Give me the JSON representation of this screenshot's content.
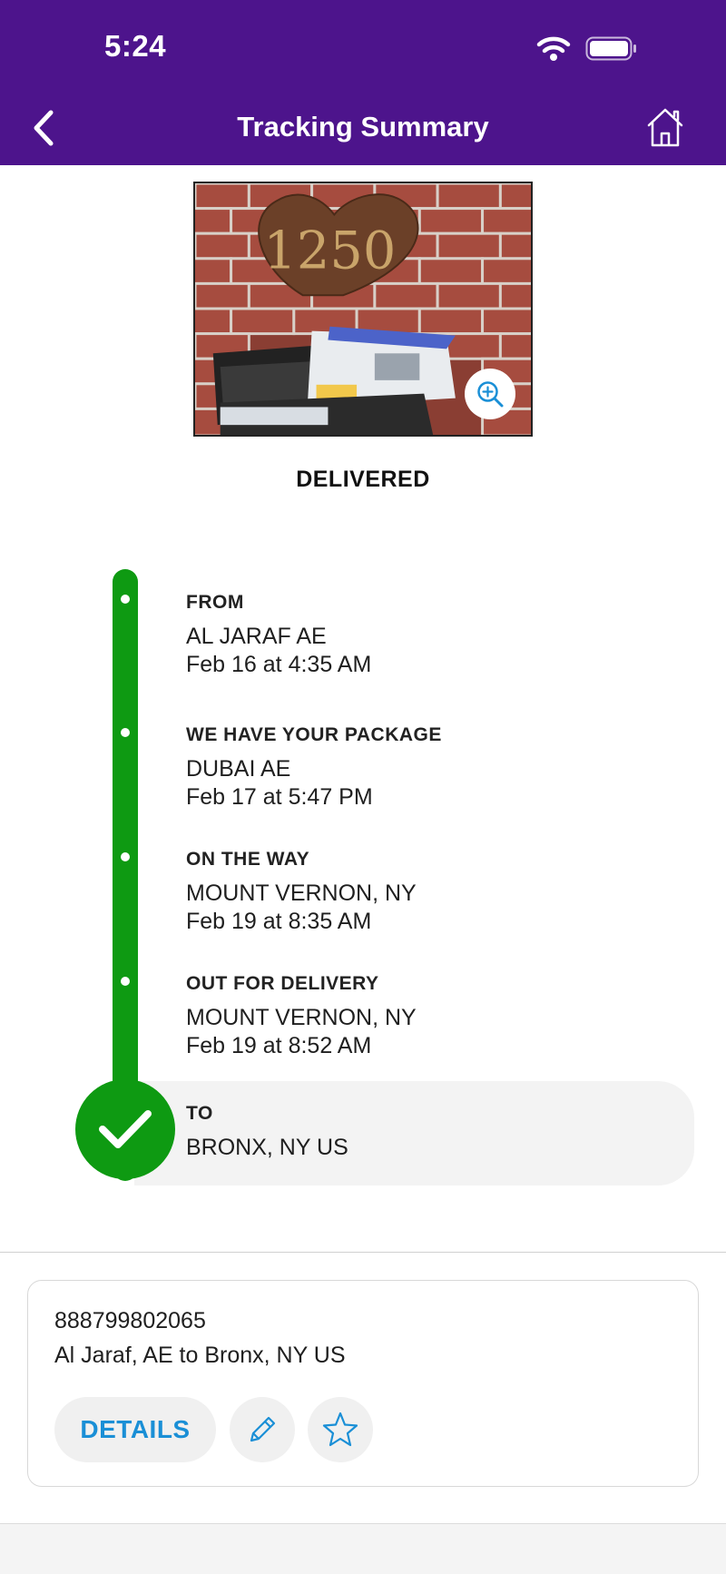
{
  "status_bar": {
    "time": "5:24"
  },
  "nav": {
    "title": "Tracking Summary"
  },
  "photo": {
    "house_number": "1250"
  },
  "delivery_status": "DELIVERED",
  "timeline": [
    {
      "title": "FROM",
      "location": "AL JARAF AE",
      "time": "Feb 16 at 4:35 AM"
    },
    {
      "title": "WE HAVE YOUR PACKAGE",
      "location": "DUBAI AE",
      "time": "Feb 17 at 5:47 PM"
    },
    {
      "title": "ON THE WAY",
      "location": "MOUNT VERNON, NY",
      "time": "Feb 19 at 8:35 AM"
    },
    {
      "title": "OUT FOR DELIVERY",
      "location": "MOUNT VERNON, NY",
      "time": "Feb 19 at 8:52 AM"
    }
  ],
  "destination": {
    "title": "TO",
    "location": "BRONX, NY  US"
  },
  "card": {
    "tracking_number": "888799802065",
    "route": "Al Jaraf, AE to Bronx, NY US",
    "details_label": "DETAILS"
  },
  "colors": {
    "header": "#4d148c",
    "timeline": "#0e9a12",
    "accent_blue": "#1a8fd6"
  },
  "icons": [
    "back-chevron-icon",
    "home-icon",
    "wifi-icon",
    "battery-icon",
    "zoom-in-icon",
    "checkmark-icon",
    "pencil-icon",
    "star-icon"
  ]
}
